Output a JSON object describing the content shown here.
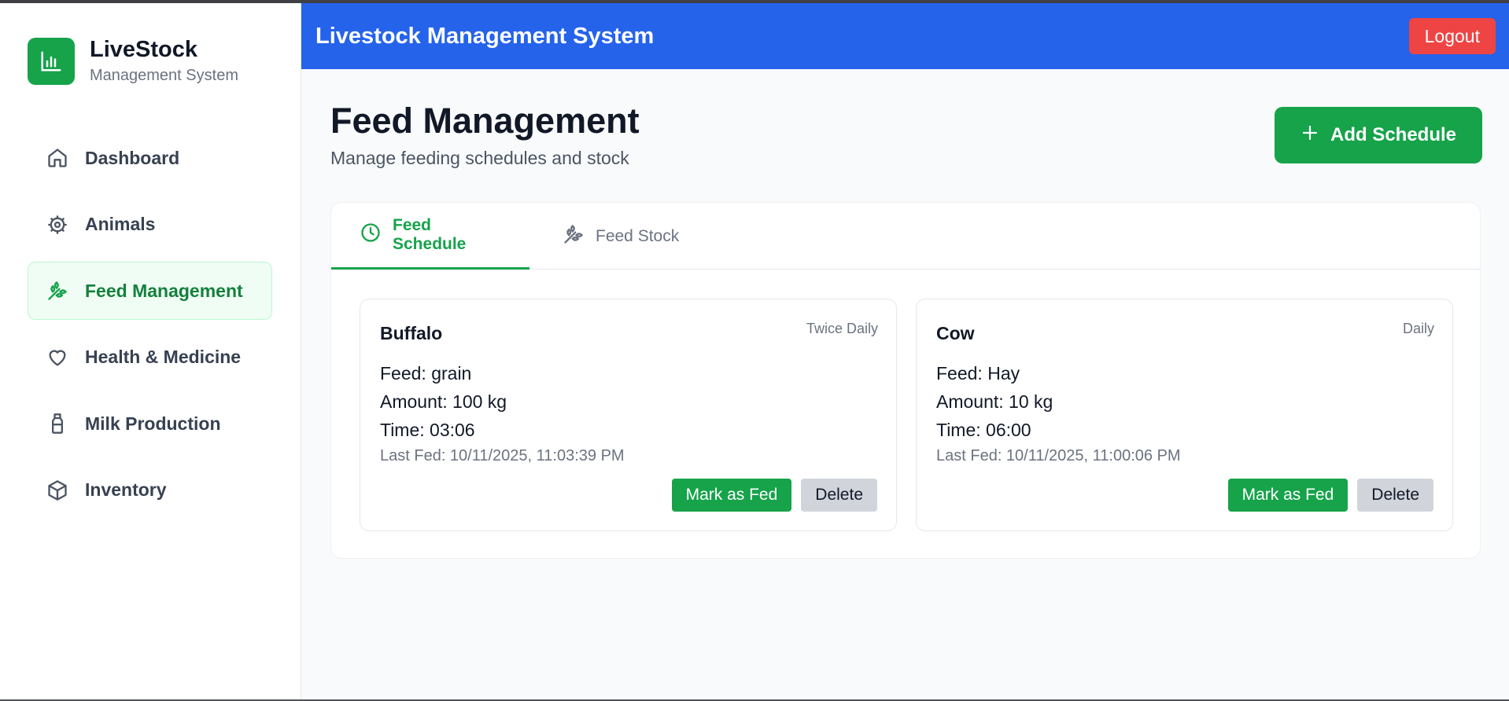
{
  "brand": {
    "name": "LiveStock",
    "subtitle": "Management System",
    "logo_icon": "bar-chart-icon",
    "accent": "#16a34a"
  },
  "sidebar": {
    "items": [
      {
        "label": "Dashboard",
        "icon": "home-icon",
        "active": false
      },
      {
        "label": "Animals",
        "icon": "gear-icon",
        "active": false
      },
      {
        "label": "Feed Management",
        "icon": "wheat-icon",
        "active": true
      },
      {
        "label": "Health & Medicine",
        "icon": "heart-icon",
        "active": false
      },
      {
        "label": "Milk Production",
        "icon": "milk-bottle-icon",
        "active": false
      },
      {
        "label": "Inventory",
        "icon": "package-icon",
        "active": false
      }
    ]
  },
  "header": {
    "title": "Livestock Management System",
    "logout_label": "Logout",
    "background": "#2563eb",
    "logout_color": "#ef4444"
  },
  "page": {
    "title": "Feed Management",
    "subtitle": "Manage feeding schedules and stock",
    "add_button_label": "Add Schedule"
  },
  "tabs": [
    {
      "label": "Feed Schedule",
      "icon": "clock-icon",
      "active": true
    },
    {
      "label": "Feed Stock",
      "icon": "wheat-icon",
      "active": false
    }
  ],
  "schedules": [
    {
      "animal": "Buffalo",
      "frequency": "Twice Daily",
      "feed": "Feed: grain",
      "amount": "Amount: 100 kg",
      "time": "Time: 03:06",
      "last_fed": "Last Fed: 10/11/2025, 11:03:39 PM",
      "mark_label": "Mark as Fed",
      "delete_label": "Delete"
    },
    {
      "animal": "Cow",
      "frequency": "Daily",
      "feed": "Feed: Hay",
      "amount": "Amount: 10 kg",
      "time": "Time: 06:00",
      "last_fed": "Last Fed: 10/11/2025, 11:00:06 PM",
      "mark_label": "Mark as Fed",
      "delete_label": "Delete"
    }
  ]
}
